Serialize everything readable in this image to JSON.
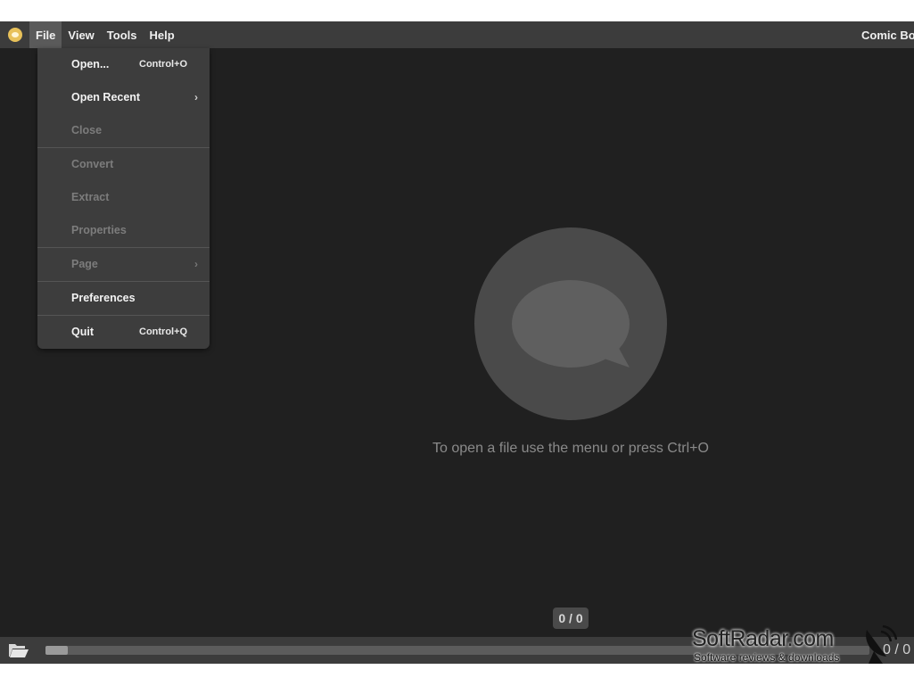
{
  "window": {
    "title": "Comic Bo"
  },
  "menubar": {
    "items": [
      {
        "label": "File",
        "active": true
      },
      {
        "label": "View"
      },
      {
        "label": "Tools"
      },
      {
        "label": "Help"
      }
    ]
  },
  "file_menu": {
    "items": [
      {
        "label": "Open...",
        "shortcut": "Control+O",
        "enabled": true
      },
      {
        "label": "Open Recent",
        "submenu_arrow": "›",
        "enabled": true
      },
      {
        "label": "Close",
        "enabled": false
      },
      {
        "label": "Convert",
        "enabled": false
      },
      {
        "label": "Extract",
        "enabled": false
      },
      {
        "label": "Properties",
        "enabled": false
      },
      {
        "label": "Page",
        "submenu_arrow": "›",
        "enabled": false
      },
      {
        "label": "Preferences",
        "enabled": true
      },
      {
        "label": "Quit",
        "shortcut": "Control+Q",
        "enabled": true
      }
    ]
  },
  "main": {
    "hint": "To open a file use the menu or press Ctrl+O",
    "page_badge": "0 / 0"
  },
  "bottombar": {
    "page_counter": "0 / 0",
    "slider_progress": 0
  },
  "watermark": {
    "title": "SoftRadar.com",
    "subtitle": "Software reviews & downloads"
  },
  "colors": {
    "background": "#202020",
    "menubar": "#3c3c3c",
    "dropdown": "#3d3d3d",
    "app_icon": "#e8c15a",
    "welcome_circle": "#4a4a4a"
  },
  "icons": {
    "app": "comic-bubble-icon",
    "open": "folder-open-icon",
    "welcome": "speech-bubble-icon"
  }
}
